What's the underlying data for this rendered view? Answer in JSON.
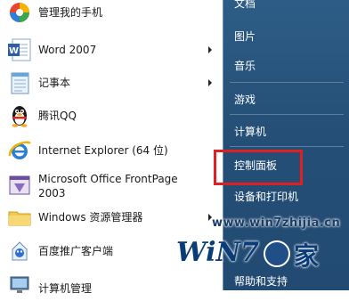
{
  "left_menu": {
    "items": [
      {
        "label": "管理我的手机",
        "icon": "phone-manager-icon",
        "has_arrow": false
      },
      {
        "label": "Word 2007",
        "icon": "word-icon",
        "has_arrow": true
      },
      {
        "label": "记事本",
        "icon": "notepad-icon",
        "has_arrow": true
      },
      {
        "label": "腾讯QQ",
        "icon": "qq-penguin-icon",
        "has_arrow": false
      },
      {
        "label": "Internet Explorer (64 位)",
        "icon": "internet-explorer-icon",
        "has_arrow": false
      },
      {
        "label": "Microsoft Office FrontPage 2003",
        "icon": "frontpage-icon",
        "has_arrow": false
      },
      {
        "label": "Windows 资源管理器",
        "icon": "folder-explorer-icon",
        "has_arrow": true
      },
      {
        "label": "百度推广客户端",
        "icon": "baidu-client-icon",
        "has_arrow": false
      },
      {
        "label": "计算机管理",
        "icon": "computer-management-icon",
        "has_arrow": false
      }
    ]
  },
  "right_menu": {
    "items": [
      {
        "label": "文档"
      },
      {
        "label": "图片"
      },
      {
        "label": "音乐"
      },
      {
        "label": "游戏"
      },
      {
        "label": "计算机"
      },
      {
        "label": "控制面板"
      },
      {
        "label": "设备和打印机"
      },
      {
        "label": "帮助和支持"
      }
    ]
  },
  "watermark": {
    "url": "www.win7zhijia.cn",
    "logo_win": "WiN7",
    "logo_jia": "家"
  },
  "colors": {
    "right_panel": "#254f77",
    "highlight_box": "#e02020"
  }
}
